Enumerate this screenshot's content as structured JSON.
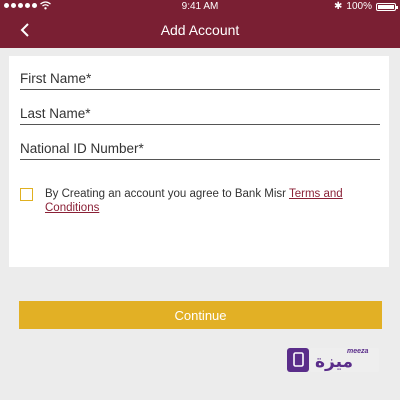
{
  "status_bar": {
    "time": "9:41 AM",
    "battery": "100%"
  },
  "header": {
    "title": "Add Account",
    "back_icon": "chevron-left-icon"
  },
  "form": {
    "first_name_placeholder": "First Name*",
    "last_name_placeholder": "Last Name*",
    "national_id_placeholder": "National ID Number*",
    "agree_text": "By Creating an account you agree to Bank Misr",
    "terms_link": "Terms and Conditions"
  },
  "continue_label": "Continue",
  "logo": {
    "brand": "meeza",
    "arabic": "ميزة"
  },
  "colors": {
    "primary": "#7a1f33",
    "accent": "#e2b025",
    "background": "#ececec"
  }
}
